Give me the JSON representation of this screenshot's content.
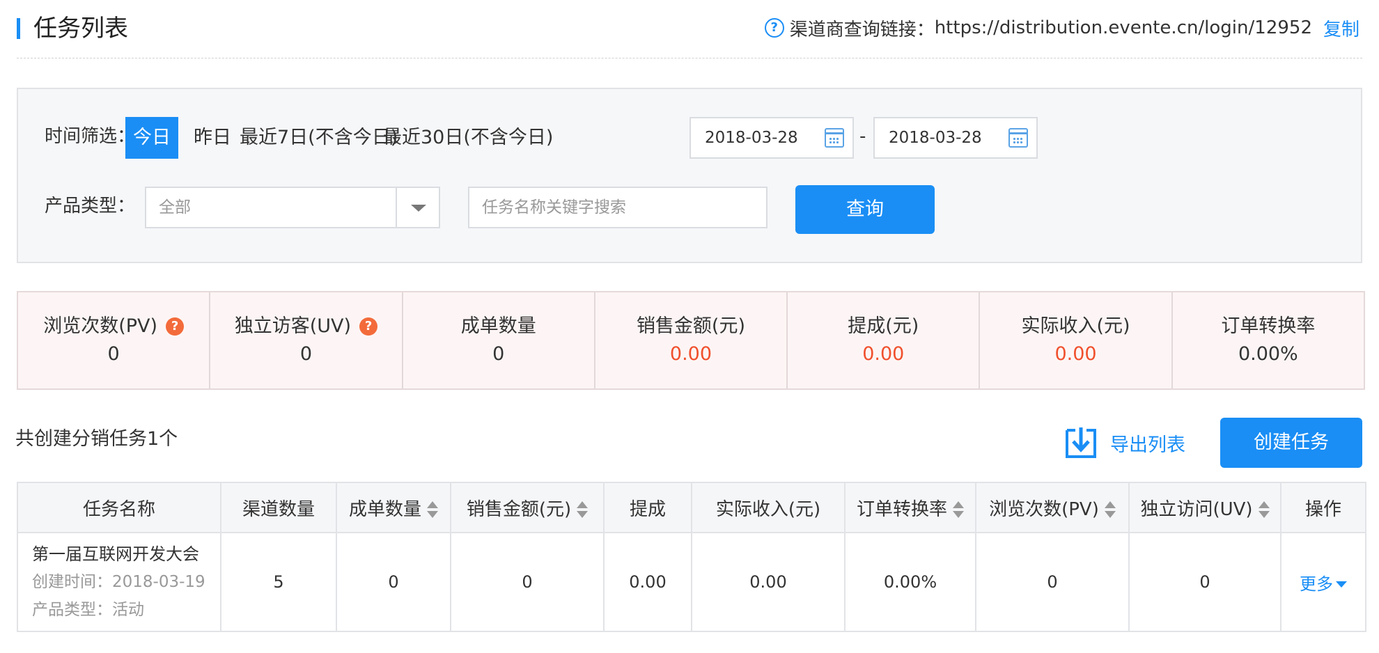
{
  "header": {
    "title": "任务列表",
    "link_label": "渠道商查询链接：",
    "link_url": "https://distribution.evente.cn/login/12952",
    "copy_label": "复制"
  },
  "filter": {
    "time_label": "时间筛选：",
    "time_options": [
      "今日",
      "昨日",
      "最近7日(不含今日)",
      "最近30日(不含今日)"
    ],
    "active_option": "今日",
    "date_start": "2018-03-28",
    "date_end": "2018-03-28",
    "date_separator": "-",
    "product_label": "产品类型：",
    "product_selected": "全部",
    "keyword_placeholder": "任务名称关键字搜索",
    "query_label": "查询"
  },
  "stats": [
    {
      "label": "浏览次数(PV)",
      "value": "0",
      "help": true
    },
    {
      "label": "独立访客(UV)",
      "value": "0",
      "help": true
    },
    {
      "label": "成单数量",
      "value": "0"
    },
    {
      "label": "销售金额(元)",
      "value": "0.00",
      "highlight": true
    },
    {
      "label": "提成(元)",
      "value": "0.00",
      "highlight": true
    },
    {
      "label": "实际收入(元)",
      "value": "0.00",
      "highlight": true
    },
    {
      "label": "订单转换率",
      "value": "0.00%"
    }
  ],
  "summary": "共创建分销任务1个",
  "actions": {
    "export_label": "导出列表",
    "create_label": "创建任务"
  },
  "table": {
    "columns": [
      {
        "label": "任务名称",
        "sortable": false
      },
      {
        "label": "渠道数量",
        "sortable": false
      },
      {
        "label": "成单数量",
        "sortable": true
      },
      {
        "label": "销售金额(元)",
        "sortable": true
      },
      {
        "label": "提成",
        "sortable": false
      },
      {
        "label": "实际收入(元)",
        "sortable": false
      },
      {
        "label": "订单转换率",
        "sortable": true
      },
      {
        "label": "浏览次数(PV)",
        "sortable": true
      },
      {
        "label": "独立访问(UV)",
        "sortable": true
      },
      {
        "label": "操作",
        "sortable": false
      }
    ],
    "rows": [
      {
        "name": "第一届互联网开发大会",
        "created": "创建时间：2018-03-19",
        "product_type": "产品类型：活动",
        "channels": "5",
        "orders": "0",
        "sales": "0",
        "commission": "0.00",
        "income": "0.00",
        "conversion": "0.00%",
        "pv": "0",
        "uv": "0",
        "action": "更多"
      }
    ]
  },
  "colors": {
    "primary": "#1a8ef5",
    "highlight": "#f0502d",
    "stats_bg": "#fdf5f5",
    "filter_bg": "#f6f7f9"
  }
}
